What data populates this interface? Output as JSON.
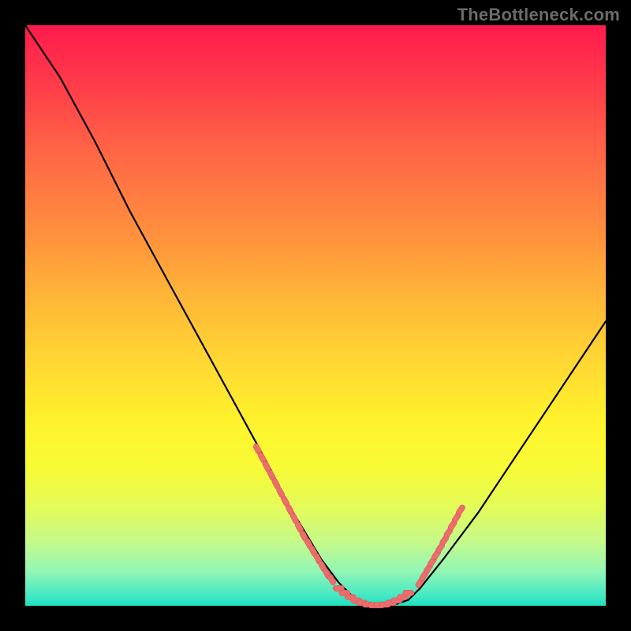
{
  "watermark": "TheBottleneck.com",
  "palette": {
    "curve": "#000000",
    "marker_fill": "#ec6d6c",
    "marker_stroke": "#d95a59"
  },
  "chart_data": {
    "type": "line",
    "title": "",
    "xlabel": "",
    "ylabel": "",
    "xlim": [
      0,
      100
    ],
    "ylim": [
      0,
      100
    ],
    "grid": false,
    "legend": false,
    "series": [
      {
        "name": "curve",
        "x": [
          0,
          6,
          12,
          18,
          24,
          30,
          36,
          42,
          45,
          48,
          51,
          54,
          57,
          60,
          63,
          66,
          68,
          72,
          78,
          84,
          90,
          96,
          100
        ],
        "y": [
          100,
          91,
          80,
          68,
          57,
          46,
          35,
          24,
          18,
          13,
          8,
          4,
          1,
          0,
          0,
          1,
          3,
          8,
          16,
          25,
          34,
          43,
          49
        ]
      }
    ],
    "markers_left": [
      {
        "x": 40.0,
        "y": 27.0
      },
      {
        "x": 40.8,
        "y": 25.5
      },
      {
        "x": 41.6,
        "y": 24.0
      },
      {
        "x": 42.4,
        "y": 22.5
      },
      {
        "x": 43.2,
        "y": 21.0
      },
      {
        "x": 44.0,
        "y": 19.5
      },
      {
        "x": 44.8,
        "y": 18.0
      },
      {
        "x": 45.6,
        "y": 16.5
      },
      {
        "x": 46.4,
        "y": 15.0
      },
      {
        "x": 47.2,
        "y": 13.5
      },
      {
        "x": 48.0,
        "y": 12.0
      },
      {
        "x": 48.8,
        "y": 10.7
      },
      {
        "x": 49.6,
        "y": 9.4
      },
      {
        "x": 50.4,
        "y": 8.1
      },
      {
        "x": 51.2,
        "y": 6.8
      },
      {
        "x": 52.0,
        "y": 5.5
      },
      {
        "x": 52.8,
        "y": 4.5
      }
    ],
    "markers_bottom": [
      {
        "x": 54.0,
        "y": 3.0
      },
      {
        "x": 55.0,
        "y": 2.2
      },
      {
        "x": 56.0,
        "y": 1.5
      },
      {
        "x": 57.0,
        "y": 0.9
      },
      {
        "x": 58.0,
        "y": 0.5
      },
      {
        "x": 59.0,
        "y": 0.2
      },
      {
        "x": 60.0,
        "y": 0.1
      },
      {
        "x": 61.0,
        "y": 0.1
      },
      {
        "x": 62.0,
        "y": 0.2
      },
      {
        "x": 63.0,
        "y": 0.5
      },
      {
        "x": 64.0,
        "y": 0.9
      },
      {
        "x": 65.0,
        "y": 1.5
      },
      {
        "x": 66.0,
        "y": 2.2
      }
    ],
    "markers_right": [
      {
        "x": 68.0,
        "y": 4.0
      },
      {
        "x": 68.7,
        "y": 5.2
      },
      {
        "x": 69.4,
        "y": 6.4
      },
      {
        "x": 70.1,
        "y": 7.6
      },
      {
        "x": 70.8,
        "y": 8.8
      },
      {
        "x": 71.5,
        "y": 10.0
      },
      {
        "x": 72.2,
        "y": 11.3
      },
      {
        "x": 72.9,
        "y": 12.6
      },
      {
        "x": 73.6,
        "y": 13.9
      },
      {
        "x": 74.3,
        "y": 15.2
      },
      {
        "x": 75.0,
        "y": 16.5
      }
    ]
  }
}
